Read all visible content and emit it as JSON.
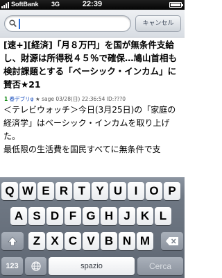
{
  "status_bar": {
    "carrier": "SoftBank",
    "network": "3G",
    "time": "22:39"
  },
  "search": {
    "value": "",
    "cancel_label": "キャンセル"
  },
  "thread": {
    "title": "[速+][経済]「月８万円」を国が無条件支給し、財源は所得税４５％で確保…鳩山首相も検討課題とする「ベーシック・インカム」に賛否★21"
  },
  "post": {
    "number": "1",
    "name": "春デブリφ",
    "mark": "★",
    "mail": "sage",
    "date": "03/28(日) 22:36:54",
    "id": "ID:???0",
    "body": "＜テレビウォッチ＞今日(3月25日)の「家庭の経済学」はベーシック・インカムを取り上げた。\n最低限の生活費を国民すべてに無条件で支"
  },
  "keyboard": {
    "row1": [
      "Q",
      "W",
      "E",
      "R",
      "T",
      "Y",
      "U",
      "I",
      "O",
      "P"
    ],
    "row2": [
      "A",
      "S",
      "D",
      "F",
      "G",
      "H",
      "J",
      "K",
      "L"
    ],
    "row3": [
      "Z",
      "X",
      "C",
      "V",
      "B",
      "N",
      "M"
    ],
    "numbers_label": "123",
    "space_label": "spazio",
    "search_label": "Cerca",
    "icons": {
      "shift": "shift-arrow-icon",
      "delete": "delete-backspace-icon",
      "globe": "globe-icon"
    }
  }
}
